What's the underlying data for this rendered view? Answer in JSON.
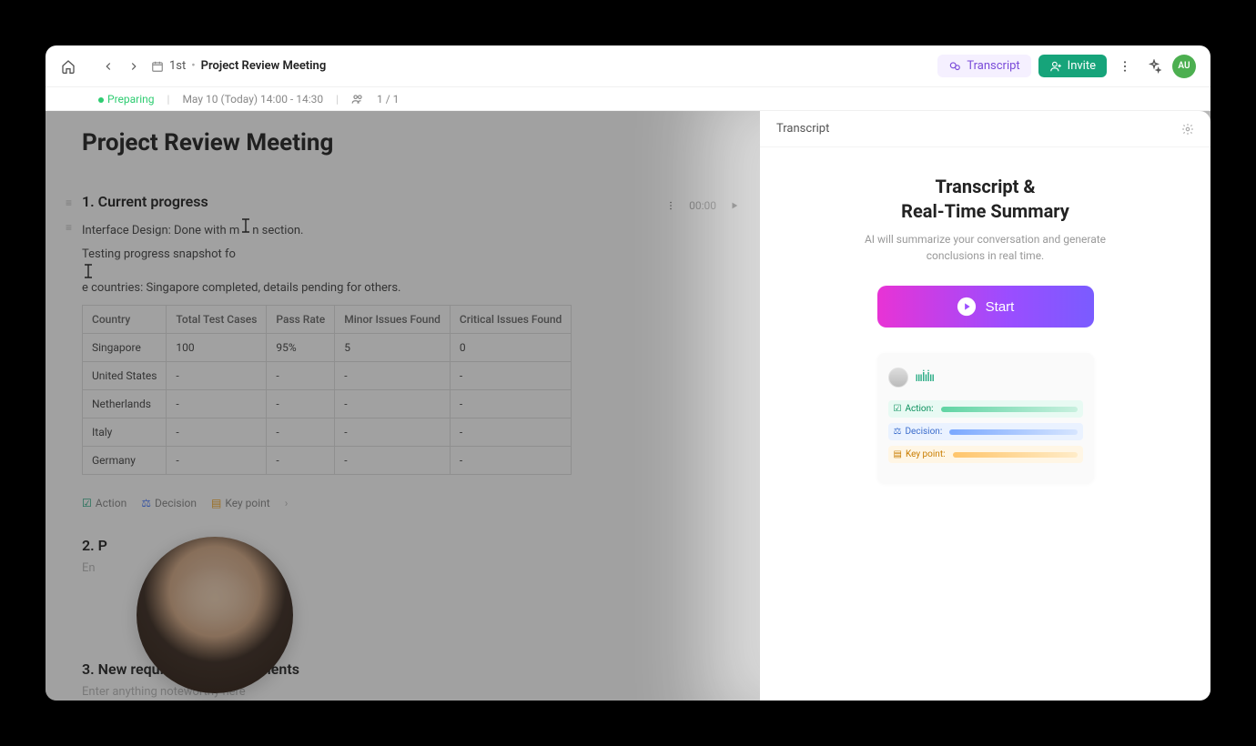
{
  "topbar": {
    "breadcrumb_folder": "1st",
    "breadcrumb_page": "Project Review Meeting",
    "transcript_label": "Transcript",
    "invite_label": "Invite",
    "avatar_initials": "AU"
  },
  "subbar": {
    "status": "Preparing",
    "datetime": "May 10 (Today) 14:00 - 14:30",
    "attendees": "1 / 1"
  },
  "page": {
    "title": "Project Review Meeting"
  },
  "section1": {
    "heading": "1. Current progress",
    "timer": "00:00",
    "line1_pre": "Interface Design: Done with m",
    "line1_post": "n section.",
    "line2_pre": "Testing progress snapshot fo",
    "line2_post": "e countries: Singapore completed, details pending for others."
  },
  "table": {
    "headers": [
      "Country",
      "Total Test Cases",
      "Pass Rate",
      "Minor Issues Found",
      "Critical Issues Found"
    ],
    "rows": [
      [
        "Singapore",
        "100",
        "95%",
        "5",
        "0"
      ],
      [
        "United States",
        "-",
        "-",
        "-",
        "-"
      ],
      [
        "Netherlands",
        "-",
        "-",
        "-",
        "-"
      ],
      [
        "Italy",
        "-",
        "-",
        "-",
        "-"
      ],
      [
        "Germany",
        "-",
        "-",
        "-",
        "-"
      ]
    ]
  },
  "tags": {
    "action": "Action",
    "decision": "Decision",
    "keypoint": "Key point"
  },
  "section2": {
    "heading_visible": "2. P",
    "placeholder": "En"
  },
  "section3": {
    "heading": "3. New requirements from clients",
    "placeholder": "Enter anything noteworthy here"
  },
  "panel": {
    "header": "Transcript",
    "title_line1": "Transcript &",
    "title_line2": "Real-Time Summary",
    "subtitle": "AI will summarize your conversation and generate conclusions in real time.",
    "start_label": "Start",
    "preview_action": "Action:",
    "preview_decision": "Decision:",
    "preview_keypoint": "Key point:"
  }
}
